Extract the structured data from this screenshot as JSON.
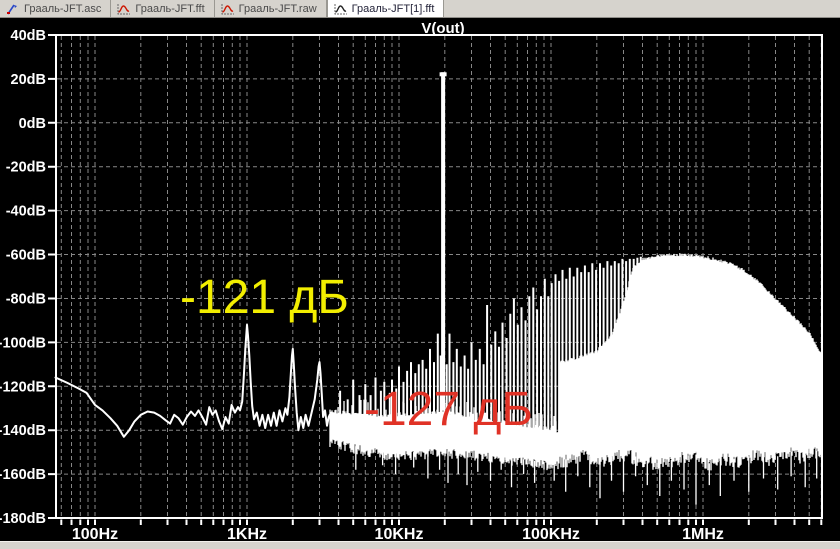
{
  "tabs": [
    {
      "label": "Грааль-JFT.asc",
      "name": "tab-asc",
      "icon": "schematic-icon",
      "icon_color": "#2a48c8",
      "active": false
    },
    {
      "label": "Грааль-JFT.fft",
      "name": "tab-fft",
      "icon": "waveform-icon",
      "icon_color": "#cc1500",
      "active": false
    },
    {
      "label": "Грааль-JFT.raw",
      "name": "tab-raw",
      "icon": "waveform-icon",
      "icon_color": "#cc1500",
      "active": false
    },
    {
      "label": "Грааль-JFT[1].fft",
      "name": "tab-fft-1",
      "icon": "waveform-icon",
      "icon_color": "#222222",
      "active": true
    }
  ],
  "colors": {
    "background": "#000000",
    "grid": "#878787",
    "trace": "#ffffff",
    "axis_text": "#ffffff",
    "chrome": "#d6d3cd",
    "annotation_yellow": "#f2ee00",
    "annotation_red": "#e03226"
  },
  "chart_data": {
    "type": "line",
    "title": "V(out)",
    "x_axis": {
      "scale": "log",
      "unit": "Hz",
      "range_hz": [
        55,
        6070000
      ],
      "ticks": [
        {
          "label": "100Hz",
          "f": 100
        },
        {
          "label": "1KHz",
          "f": 1000
        },
        {
          "label": "10KHz",
          "f": 10000
        },
        {
          "label": "100KHz",
          "f": 100000
        },
        {
          "label": "1MHz",
          "f": 1000000
        }
      ]
    },
    "y_axis": {
      "unit": "dB",
      "range_db": [
        -180,
        40
      ],
      "tick_labels": [
        "40dB",
        "20dB",
        "0dB",
        "-20dB",
        "-40dB",
        "-60dB",
        "-80dB",
        "-100dB",
        "-120dB",
        "-140dB",
        "-160dB",
        "-180dB"
      ],
      "tick_values": [
        40,
        20,
        0,
        -20,
        -40,
        -60,
        -80,
        -100,
        -120,
        -140,
        -160,
        -180
      ]
    },
    "annotations": [
      {
        "text": "-121 дБ",
        "value_db": -121,
        "refers_to": "1KHz harmonic peak",
        "color": "#f2ee00"
      },
      {
        "text": "-127 дБ",
        "value_db": -127,
        "refers_to": "noise floor",
        "color": "#e03226"
      }
    ],
    "carrier": {
      "f": 19500,
      "top_db": 23
    },
    "trace_db_vs_hz": [
      [
        55,
        -116
      ],
      [
        66,
        -118.5
      ],
      [
        78,
        -121
      ],
      [
        88,
        -123
      ],
      [
        100,
        -128.5
      ],
      [
        112,
        -131
      ],
      [
        126,
        -134.5
      ],
      [
        140,
        -138
      ],
      [
        155,
        -143
      ],
      [
        168,
        -140
      ],
      [
        182,
        -136
      ],
      [
        200,
        -133
      ],
      [
        222,
        -131.5
      ],
      [
        245,
        -132
      ],
      [
        268,
        -133.5
      ],
      [
        292,
        -135.5
      ],
      [
        312,
        -137
      ],
      [
        332,
        -133
      ],
      [
        354,
        -134.5
      ],
      [
        378,
        -137.5
      ],
      [
        402,
        -134
      ],
      [
        428,
        -131.5
      ],
      [
        455,
        -133.5
      ],
      [
        480,
        -131
      ],
      [
        508,
        -134
      ],
      [
        538,
        -137.5
      ],
      [
        565,
        -129.5
      ],
      [
        592,
        -133
      ],
      [
        622,
        -131
      ],
      [
        655,
        -136
      ],
      [
        688,
        -139.5
      ],
      [
        722,
        -134
      ],
      [
        758,
        -137
      ],
      [
        792,
        -128.5
      ],
      [
        832,
        -132
      ],
      [
        872,
        -129.5
      ],
      [
        900,
        -131
      ],
      [
        930,
        -127
      ],
      [
        955,
        -114
      ],
      [
        975,
        -103
      ],
      [
        1000,
        -92
      ],
      [
        1015,
        -97
      ],
      [
        1035,
        -106
      ],
      [
        1058,
        -118
      ],
      [
        1082,
        -129
      ],
      [
        1112,
        -135
      ],
      [
        1160,
        -132
      ],
      [
        1210,
        -138
      ],
      [
        1262,
        -133
      ],
      [
        1318,
        -139
      ],
      [
        1376,
        -133
      ],
      [
        1438,
        -138
      ],
      [
        1500,
        -132
      ],
      [
        1566,
        -138
      ],
      [
        1636,
        -131
      ],
      [
        1710,
        -136
      ],
      [
        1790,
        -130
      ],
      [
        1845,
        -133
      ],
      [
        1902,
        -125
      ],
      [
        1948,
        -113
      ],
      [
        1978,
        -106
      ],
      [
        2000,
        -103
      ],
      [
        2032,
        -110
      ],
      [
        2072,
        -121
      ],
      [
        2122,
        -132
      ],
      [
        2180,
        -140
      ],
      [
        2260,
        -134
      ],
      [
        2345,
        -139
      ],
      [
        2430,
        -133
      ],
      [
        2540,
        -138
      ],
      [
        2660,
        -132
      ],
      [
        2790,
        -126
      ],
      [
        2900,
        -117
      ],
      [
        2960,
        -111
      ],
      [
        3000,
        -109
      ],
      [
        3045,
        -114
      ],
      [
        3100,
        -123
      ],
      [
        3165,
        -134
      ],
      [
        3260,
        -131
      ],
      [
        3360,
        -138
      ],
      [
        3450,
        -134
      ],
      [
        3500,
        -133
      ]
    ],
    "noise_band": {
      "top": [
        [
          3500,
          -131
        ],
        [
          5000,
          -132
        ],
        [
          8000,
          -133
        ],
        [
          12000,
          -132
        ],
        [
          20000,
          -131
        ],
        [
          30000,
          -134
        ],
        [
          50000,
          -136
        ],
        [
          80000,
          -138
        ],
        [
          114000,
          -140
        ]
      ],
      "bottom": [
        [
          3500,
          -145
        ],
        [
          5000,
          -148
        ],
        [
          8000,
          -151
        ],
        [
          12000,
          -151
        ],
        [
          20000,
          -150
        ],
        [
          30000,
          -151
        ],
        [
          50000,
          -153
        ],
        [
          80000,
          -155
        ],
        [
          114000,
          -156
        ]
      ]
    },
    "spikes": [
      [
        4100,
        -122
      ],
      [
        4600,
        -126
      ],
      [
        5000,
        -117
      ],
      [
        5500,
        -124
      ],
      [
        6000,
        -119
      ],
      [
        6500,
        -124
      ],
      [
        7000,
        -116
      ],
      [
        7600,
        -122
      ],
      [
        8000,
        -118
      ],
      [
        8700,
        -123
      ],
      [
        9000,
        -117
      ],
      [
        9600,
        -121
      ],
      [
        10000,
        -111
      ],
      [
        10700,
        -118
      ],
      [
        11300,
        -113
      ],
      [
        12000,
        -109
      ],
      [
        12800,
        -114
      ],
      [
        13500,
        -110
      ],
      [
        14300,
        -108
      ],
      [
        15100,
        -112
      ],
      [
        16000,
        -103
      ],
      [
        17000,
        -109
      ],
      [
        18000,
        -96
      ],
      [
        18800,
        -106
      ],
      [
        20600,
        -110
      ],
      [
        21500,
        -96
      ],
      [
        22800,
        -109
      ],
      [
        24000,
        -103
      ],
      [
        25500,
        -111
      ],
      [
        27000,
        -106
      ],
      [
        28500,
        -112
      ],
      [
        30000,
        -100
      ],
      [
        32000,
        -108
      ],
      [
        34000,
        -103
      ],
      [
        36000,
        -110
      ],
      [
        38000,
        -83
      ],
      [
        40500,
        -101
      ],
      [
        43000,
        -95
      ],
      [
        45500,
        -102
      ],
      [
        48000,
        -91
      ],
      [
        51000,
        -98
      ],
      [
        54000,
        -87
      ],
      [
        57000,
        -80
      ],
      [
        60500,
        -92
      ],
      [
        64000,
        -84
      ],
      [
        68000,
        -90
      ],
      [
        72000,
        -79
      ],
      [
        76500,
        -75
      ],
      [
        81000,
        -85
      ],
      [
        86000,
        -79
      ],
      [
        91000,
        -71
      ],
      [
        96000,
        -79
      ],
      [
        101000,
        -73
      ],
      [
        107000,
        -69
      ],
      [
        113000,
        -72
      ],
      [
        119000,
        -67
      ],
      [
        126000,
        -71
      ],
      [
        133000,
        -66
      ],
      [
        141000,
        -70
      ],
      [
        149000,
        -66
      ],
      [
        158000,
        -68
      ],
      [
        167000,
        -65
      ],
      [
        177000,
        -68
      ],
      [
        187000,
        -64
      ],
      [
        198000,
        -67
      ],
      [
        210000,
        -64
      ],
      [
        222000,
        -66
      ],
      [
        235000,
        -63
      ],
      [
        249000,
        -65
      ],
      [
        263000,
        -63
      ],
      [
        279000,
        -64
      ],
      [
        295000,
        -62
      ],
      [
        312000,
        -63
      ],
      [
        330000,
        -62
      ],
      [
        350000,
        -62
      ],
      [
        370000,
        -61.5
      ],
      [
        390000,
        -61
      ]
    ],
    "dense_region": {
      "top": [
        [
          114000,
          -109
        ],
        [
          150000,
          -107
        ],
        [
          200000,
          -104
        ],
        [
          250000,
          -97
        ],
        [
          300000,
          -82
        ],
        [
          346000,
          -66
        ],
        [
          400000,
          -62
        ],
        [
          500000,
          -60.5
        ],
        [
          700000,
          -60
        ],
        [
          900000,
          -60.5
        ],
        [
          1100000,
          -61.5
        ],
        [
          1440000,
          -63.5
        ],
        [
          1830000,
          -67
        ],
        [
          2360000,
          -72.5
        ],
        [
          3060000,
          -81
        ],
        [
          3900000,
          -88
        ],
        [
          5050000,
          -96
        ],
        [
          6070000,
          -106
        ]
      ],
      "bottom": [
        [
          114000,
          -155
        ],
        [
          160000,
          -152
        ],
        [
          220000,
          -154
        ],
        [
          300000,
          -151
        ],
        [
          400000,
          -154
        ],
        [
          550000,
          -156
        ],
        [
          700000,
          -153
        ],
        [
          900000,
          -152
        ],
        [
          1100000,
          -156
        ],
        [
          1400000,
          -153
        ],
        [
          1800000,
          -155
        ],
        [
          2300000,
          -151
        ],
        [
          2900000,
          -154
        ],
        [
          3600000,
          -150
        ],
        [
          4500000,
          -153
        ],
        [
          5500000,
          -150
        ],
        [
          6070000,
          -152
        ]
      ]
    },
    "under_spikes": [
      [
        5200,
        -158
      ],
      [
        7800,
        -156
      ],
      [
        9500,
        -160
      ],
      [
        12500,
        -157
      ],
      [
        15500,
        -162
      ],
      [
        18500,
        -158
      ],
      [
        21000,
        -164
      ],
      [
        24500,
        -160
      ],
      [
        28000,
        -165
      ],
      [
        33000,
        -159
      ],
      [
        40000,
        -163
      ],
      [
        47000,
        -158
      ],
      [
        55000,
        -166
      ],
      [
        66000,
        -160
      ],
      [
        78000,
        -164
      ],
      [
        90000,
        -158
      ],
      [
        105000,
        -163
      ],
      [
        125000,
        -168
      ],
      [
        150000,
        -161
      ],
      [
        180000,
        -166
      ],
      [
        210000,
        -171
      ],
      [
        250000,
        -163
      ],
      [
        300000,
        -168
      ],
      [
        360000,
        -161
      ],
      [
        430000,
        -165
      ],
      [
        520000,
        -170
      ],
      [
        620000,
        -163
      ],
      [
        750000,
        -167
      ],
      [
        900000,
        -174
      ],
      [
        1100000,
        -165
      ],
      [
        1300000,
        -170
      ],
      [
        1600000,
        -163
      ],
      [
        2000000,
        -168
      ],
      [
        2500000,
        -162
      ],
      [
        3100000,
        -167
      ],
      [
        3800000,
        -161
      ],
      [
        4700000,
        -166
      ],
      [
        5600000,
        -162
      ]
    ]
  }
}
